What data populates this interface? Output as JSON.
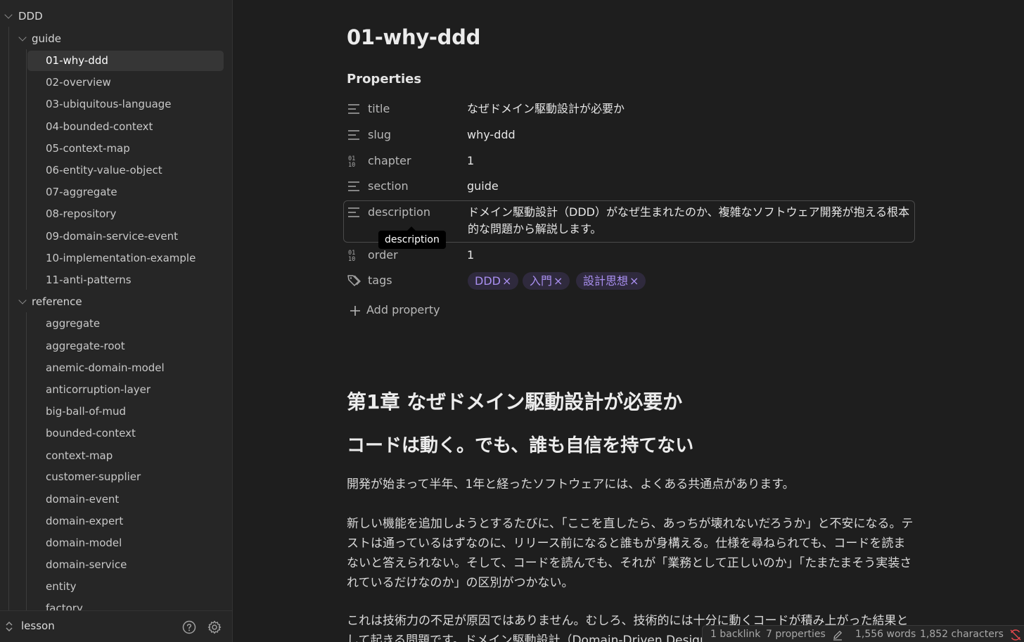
{
  "sidebar": {
    "root": "DDD",
    "folder_guide": "guide",
    "guide_items": [
      "01-why-ddd",
      "02-overview",
      "03-ubiquitous-language",
      "04-bounded-context",
      "05-context-map",
      "06-entity-value-object",
      "07-aggregate",
      "08-repository",
      "09-domain-service-event",
      "10-implementation-example",
      "11-anti-patterns"
    ],
    "folder_reference": "reference",
    "reference_items": [
      "aggregate",
      "aggregate-root",
      "anemic-domain-model",
      "anticorruption-layer",
      "big-ball-of-mud",
      "bounded-context",
      "context-map",
      "customer-supplier",
      "domain-event",
      "domain-expert",
      "domain-model",
      "domain-service",
      "entity",
      "factory"
    ],
    "active_item": "01-why-ddd",
    "vault_name": "lesson",
    "icons": {
      "vault_switch": "chevron-up-down-icon",
      "help": "help-circle-icon",
      "settings": "gear-icon"
    }
  },
  "note": {
    "title": "01-why-ddd",
    "properties_heading": "Properties",
    "properties": [
      {
        "key": "title",
        "value": "なぜドメイン駆動設計が必要か",
        "icon": "text-lines-icon"
      },
      {
        "key": "slug",
        "value": "why-ddd",
        "icon": "text-lines-icon"
      },
      {
        "key": "chapter",
        "value": "1",
        "icon": "number-icon"
      },
      {
        "key": "section",
        "value": "guide",
        "icon": "text-lines-icon"
      },
      {
        "key": "description",
        "value": "ドメイン駆動設計（DDD）がなぜ生まれたのか、複雑なソフトウェア開発が抱える根本的な問題から解説します。",
        "icon": "text-lines-icon"
      },
      {
        "key": "order",
        "value": "1",
        "icon": "number-icon"
      },
      {
        "key": "tags",
        "icon": "tags-icon"
      }
    ],
    "tags": [
      "DDD",
      "入門",
      "設計思想"
    ],
    "tag_remove_glyph": "×",
    "tooltip": "description",
    "add_property": "Add property",
    "h1": "第1章 なぜドメイン駆動設計が必要か",
    "h2": "コードは動く。でも、誰も自信を持てない",
    "paragraphs": [
      "開発が始まって半年、1年と経ったソフトウェアには、よくある共通点があります。",
      "新しい機能を追加しようとするたびに、「ここを直したら、あっちが壊れないだろうか」と不安になる。テストは通っているはずなのに、リリース前になると誰もが身構える。仕様を尋ねられても、コードを読まないと答えられない。そして、コードを読んでも、それが「業務として正しいのか」「たまたまそう実装されているだけなのか」の区別がつかない。",
      "これは技術力の不足が原因ではありません。むしろ、技術的には十分に動くコードが積み上がった結果として起きる問題です。ドメイン駆動設計（Domain-Driven Design）"
    ]
  },
  "statusbar": {
    "backlinks": "1 backlink",
    "properties": "7 properties",
    "words": "1,556 words",
    "characters": "1,852 characters"
  },
  "colors": {
    "background": "#1e1e1e",
    "sidebar": "#262626",
    "tag_bg": "#2f2a3d",
    "tag_text": "#a98ff0",
    "sync_error": "#e5484d"
  }
}
